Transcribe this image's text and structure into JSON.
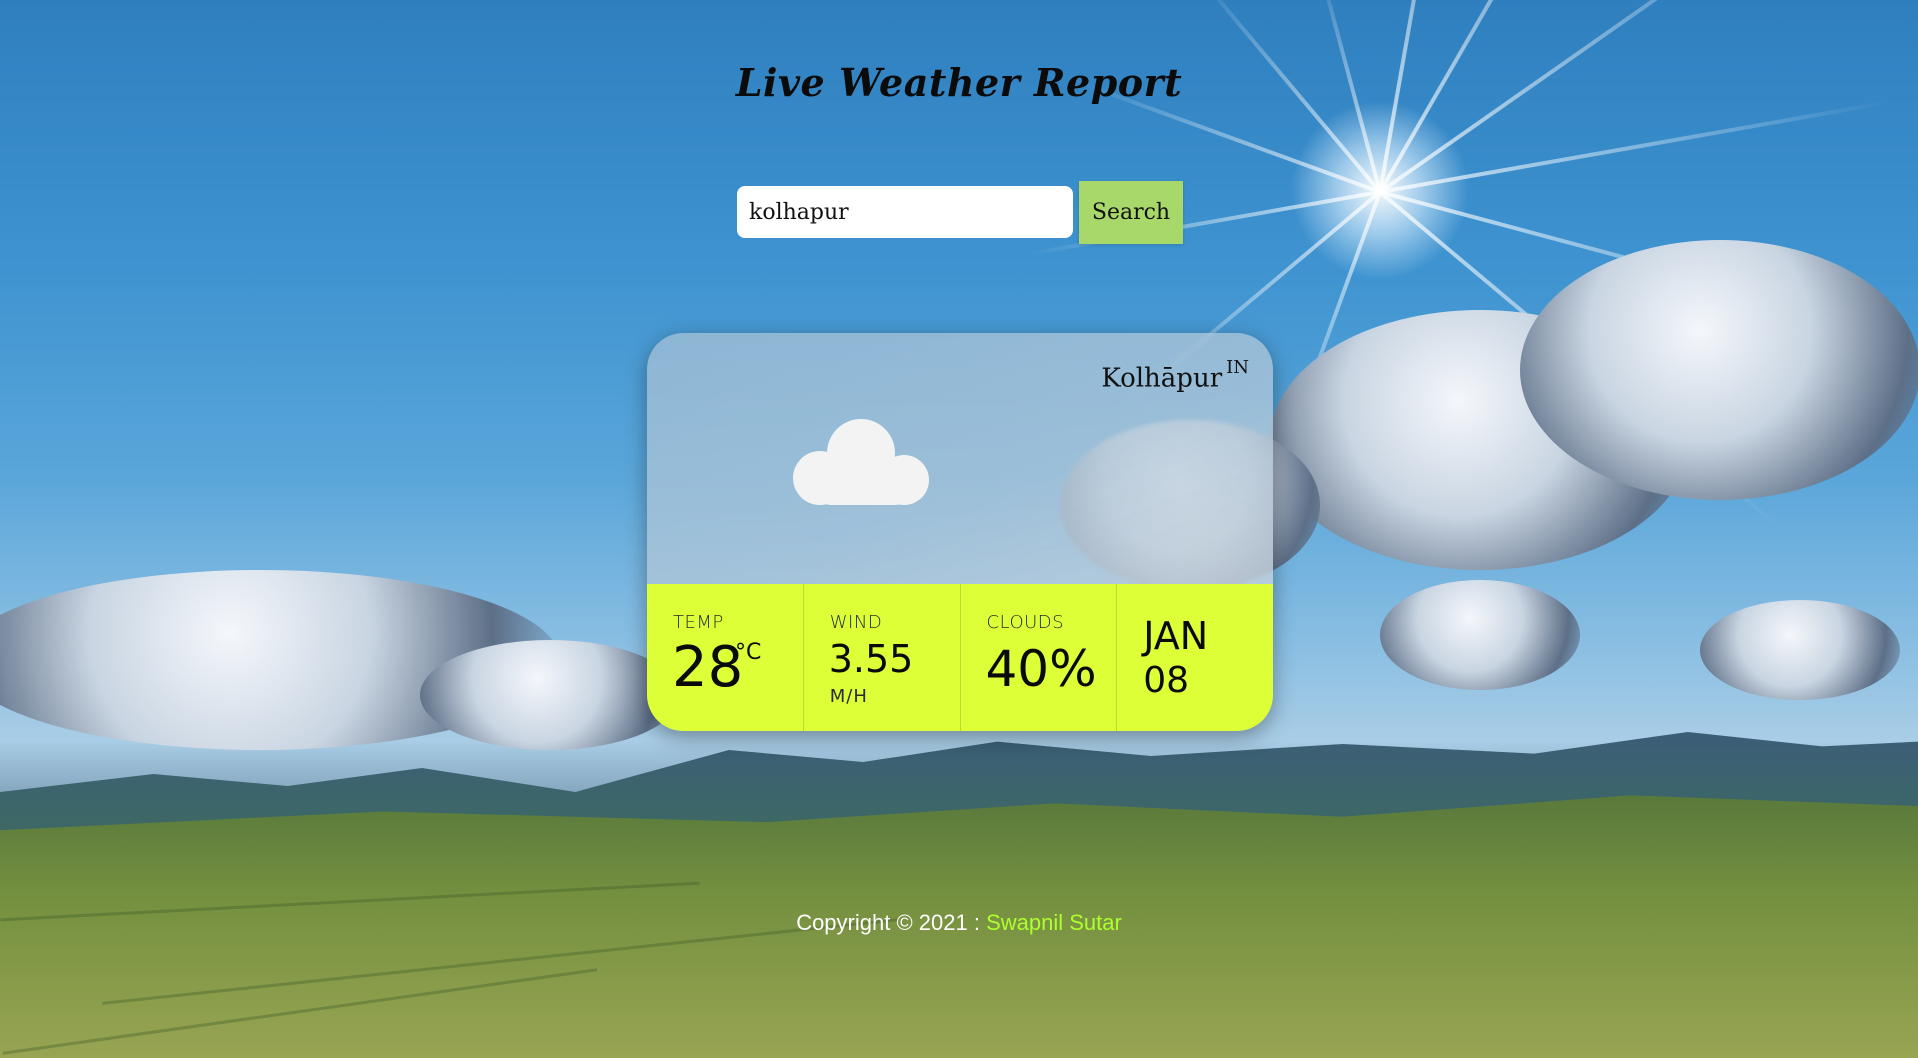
{
  "page": {
    "title": "Live Weather Report"
  },
  "search": {
    "value": "kolhapur",
    "button_label": "Search"
  },
  "card": {
    "city": "Kolhāpur",
    "country": "IN",
    "weather_icon": "cloud-icon",
    "temp": {
      "label": "TEMP",
      "value": "28",
      "unit": "°C"
    },
    "wind": {
      "label": "WIND",
      "value": "3.55",
      "unit": "M/H"
    },
    "clouds": {
      "label": "CLOUDS",
      "value": "40%"
    },
    "date": {
      "month": "JAN",
      "day": "08"
    }
  },
  "footer": {
    "prefix": "Copyright © 2021 : ",
    "author": "Swapnil Sutar"
  },
  "colors": {
    "stats_bar": "#dcff38",
    "search_button": "#a8d86a",
    "footer_link": "#adff2f"
  }
}
